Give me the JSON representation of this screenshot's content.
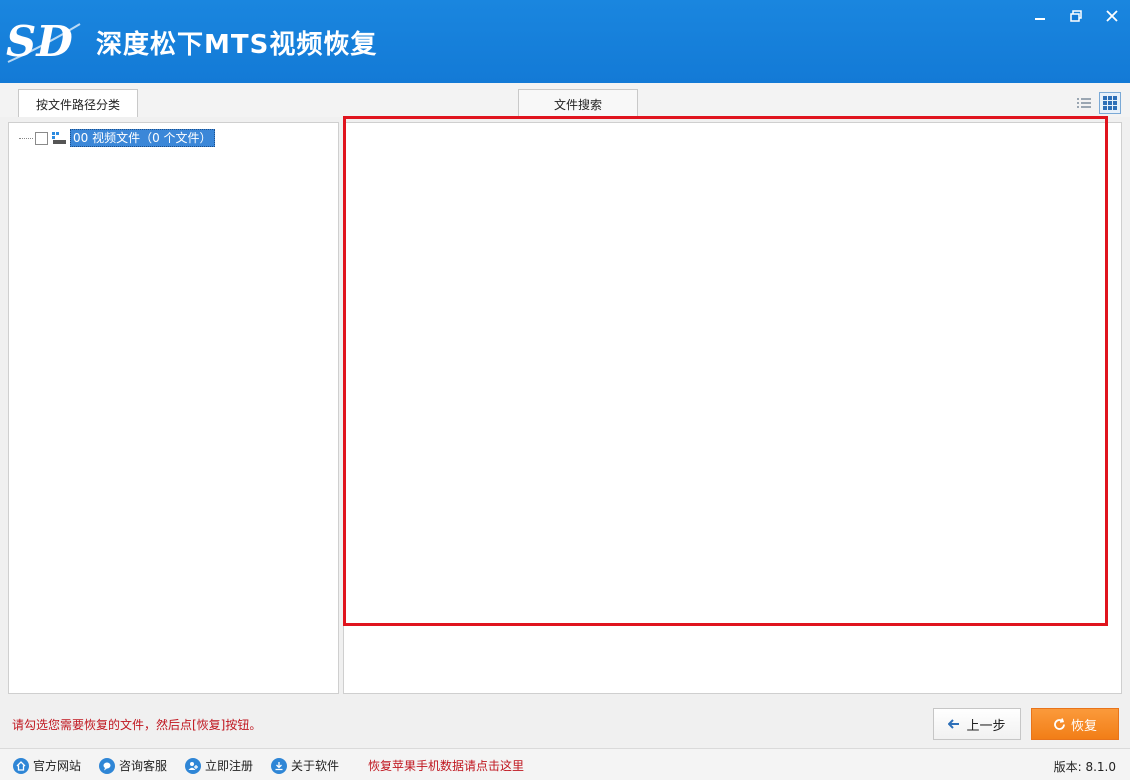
{
  "window": {
    "title": "深度松下MTS视频恢复",
    "logo_text": "SD"
  },
  "tabs": [
    {
      "label": "按文件路径分类"
    },
    {
      "label": "文件搜索"
    }
  ],
  "tree": {
    "root_label": "00 视频文件（0 个文件）"
  },
  "status": {
    "hint": "请勾选您需要恢复的文件，然后点[恢复]按钮。"
  },
  "buttons": {
    "prev": "上一步",
    "recover": "恢复"
  },
  "footer": {
    "links": [
      {
        "label": "官方网站",
        "icon": "home-icon"
      },
      {
        "label": "咨询客服",
        "icon": "chat-icon"
      },
      {
        "label": "立即注册",
        "icon": "user-add-icon"
      },
      {
        "label": "关于软件",
        "icon": "info-icon"
      }
    ],
    "apple_link": "恢复苹果手机数据请点击这里",
    "version": "版本: 8.1.0"
  },
  "colors": {
    "titlebar": "#137ad6",
    "highlight": "#e0141e",
    "recover_button": "#f27e17",
    "hint_text": "#c0161f"
  }
}
